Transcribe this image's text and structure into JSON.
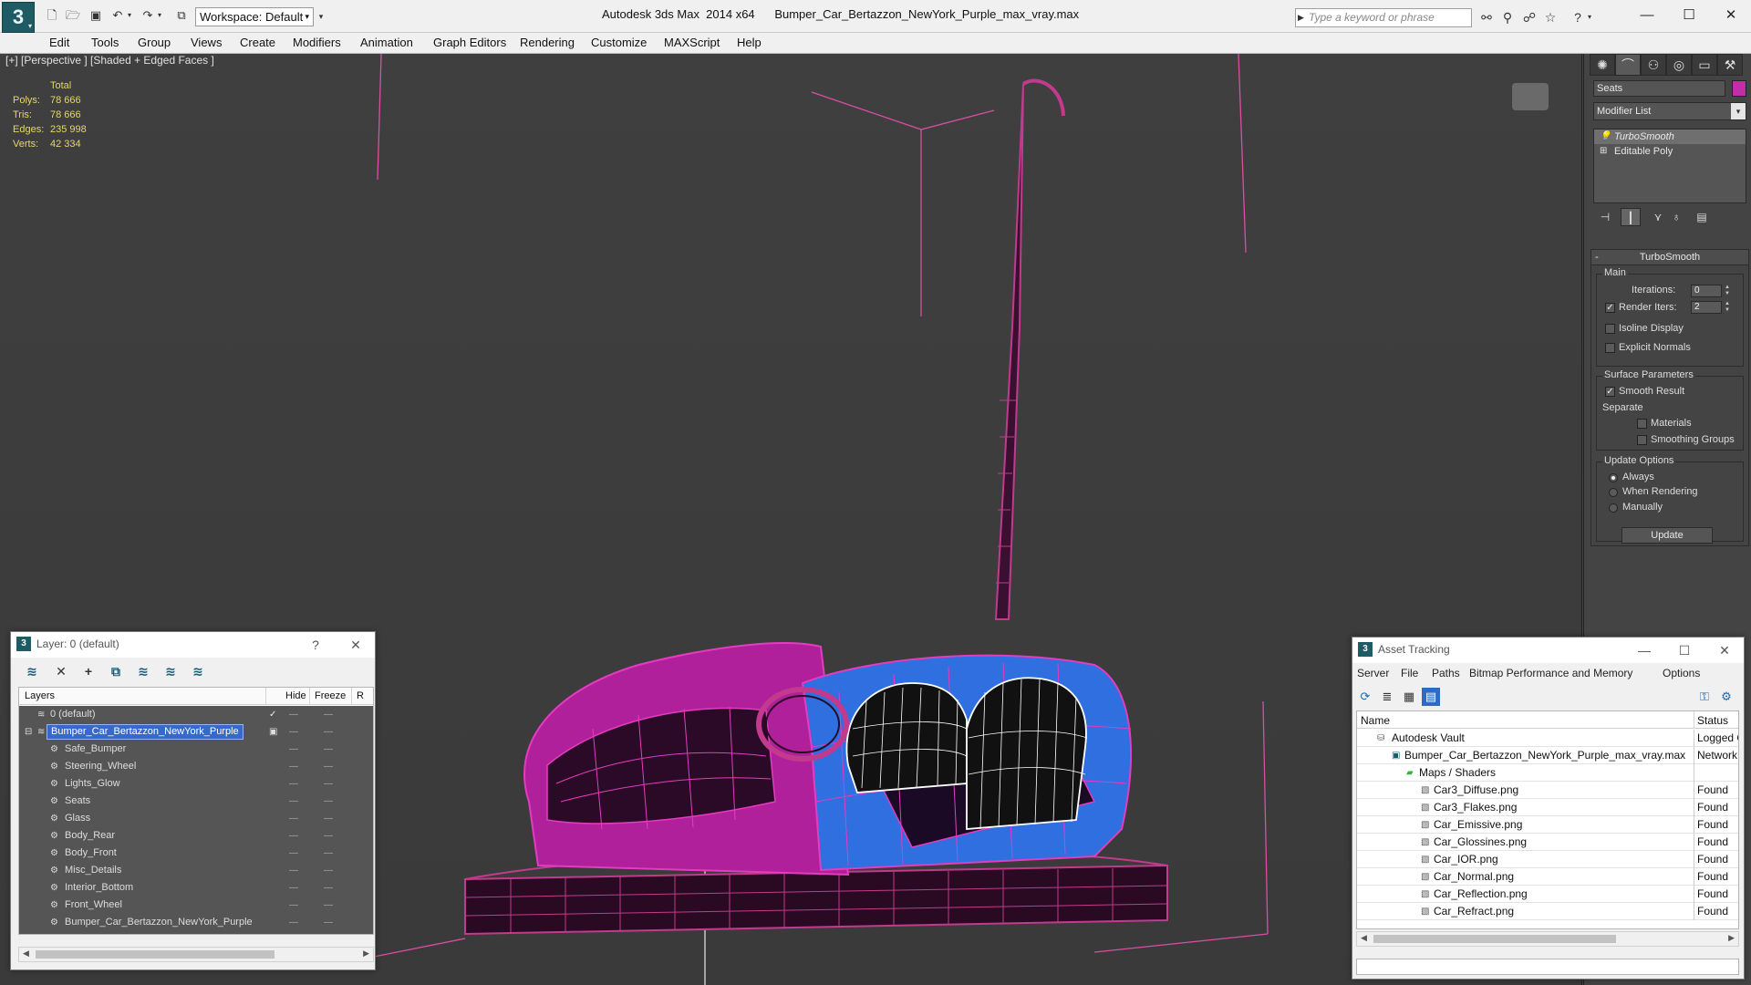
{
  "titlebar": {
    "workspace": "Workspace: Default",
    "title": "Autodesk 3ds Max  2014 x64      Bumper_Car_Bertazzon_NewYork_Purple_max_vray.max",
    "search_placeholder": "Type a keyword or phrase"
  },
  "menu": [
    "Edit",
    "Tools",
    "Group",
    "Views",
    "Create",
    "Modifiers",
    "Animation",
    "Graph Editors",
    "Rendering",
    "Customize",
    "MAXScript",
    "Help"
  ],
  "viewport": {
    "label": "[+] [Perspective ] [Shaded + Edged Faces ]",
    "stats": {
      "header": "Total",
      "rows": [
        {
          "label": "Polys:",
          "value": "78 666"
        },
        {
          "label": "Tris:",
          "value": "78 666"
        },
        {
          "label": "Edges:",
          "value": "235 998"
        },
        {
          "label": "Verts:",
          "value": "42 334"
        }
      ]
    }
  },
  "command_panel": {
    "object_name": "Seats",
    "object_color": "#c12fa8",
    "modifier_list": "Modifier List",
    "stack": [
      "TurboSmooth",
      "Editable Poly"
    ],
    "turbosmooth": {
      "title": "TurboSmooth",
      "main_label": "Main",
      "iterations_label": "Iterations:",
      "iterations": "0",
      "render_iters_label": "Render Iters:",
      "render_iters": "2",
      "isoline": "Isoline Display",
      "explicit_normals": "Explicit Normals",
      "surface_params": "Surface Parameters",
      "smooth_result": "Smooth Result",
      "separate": "Separate",
      "materials": "Materials",
      "smoothing_groups": "Smoothing Groups",
      "update_options": "Update Options",
      "always": "Always",
      "when_rendering": "When Rendering",
      "manually": "Manually",
      "update_button": "Update"
    }
  },
  "layer_manager": {
    "title": "Layer: 0 (default)",
    "help": "?",
    "columns": {
      "layers": "Layers",
      "hide": "Hide",
      "freeze": "Freeze",
      "render": "R"
    },
    "rows": [
      {
        "name": "0 (default)",
        "level": 1,
        "checked": true
      },
      {
        "name": "Bumper_Car_Bertazzon_NewYork_Purple",
        "level": 1,
        "selected": true
      },
      {
        "name": "Safe_Bumper",
        "level": 2
      },
      {
        "name": "Steering_Wheel",
        "level": 2
      },
      {
        "name": "Lights_Glow",
        "level": 2
      },
      {
        "name": "Seats",
        "level": 2
      },
      {
        "name": "Glass",
        "level": 2
      },
      {
        "name": "Body_Rear",
        "level": 2
      },
      {
        "name": "Body_Front",
        "level": 2
      },
      {
        "name": "Misc_Details",
        "level": 2
      },
      {
        "name": "Interior_Bottom",
        "level": 2
      },
      {
        "name": "Front_Wheel",
        "level": 2
      },
      {
        "name": "Bumper_Car_Bertazzon_NewYork_Purple",
        "level": 2
      }
    ]
  },
  "asset_tracking": {
    "title": "Asset Tracking",
    "menu": [
      "Server",
      "File",
      "Paths",
      "Bitmap Performance and Memory",
      "Options"
    ],
    "columns": {
      "name": "Name",
      "status": "Status"
    },
    "rows": [
      {
        "name": "Autodesk Vault",
        "level": 1,
        "status": "Logged O"
      },
      {
        "name": "Bumper_Car_Bertazzon_NewYork_Purple_max_vray.max",
        "level": 2,
        "status": "Network"
      },
      {
        "name": "Maps / Shaders",
        "level": 3,
        "status": ""
      },
      {
        "name": "Car3_Diffuse.png",
        "level": 4,
        "status": "Found"
      },
      {
        "name": "Car3_Flakes.png",
        "level": 4,
        "status": "Found"
      },
      {
        "name": "Car_Emissive.png",
        "level": 4,
        "status": "Found"
      },
      {
        "name": "Car_Glossines.png",
        "level": 4,
        "status": "Found"
      },
      {
        "name": "Car_IOR.png",
        "level": 4,
        "status": "Found"
      },
      {
        "name": "Car_Normal.png",
        "level": 4,
        "status": "Found"
      },
      {
        "name": "Car_Reflection.png",
        "level": 4,
        "status": "Found"
      },
      {
        "name": "Car_Refract.png",
        "level": 4,
        "status": "Found"
      }
    ]
  }
}
